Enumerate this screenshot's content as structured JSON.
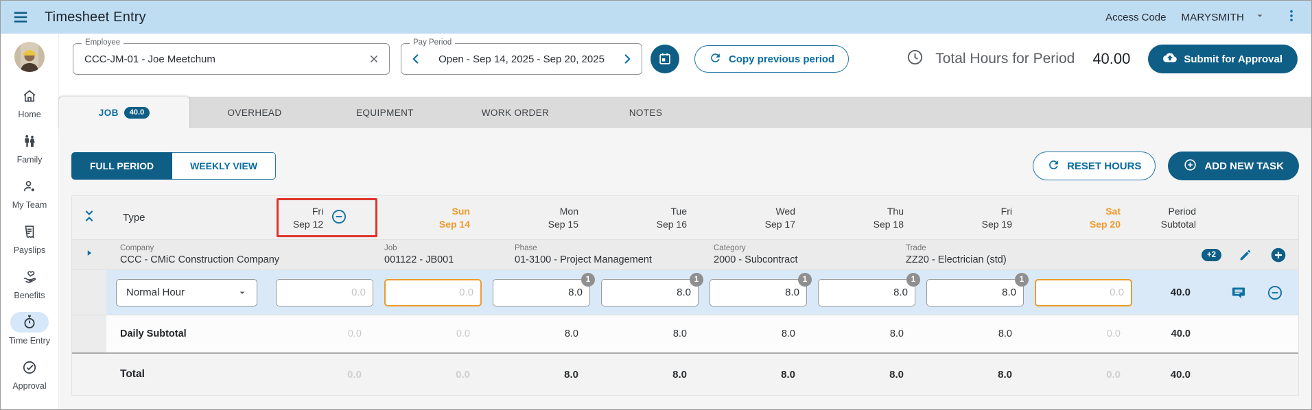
{
  "topbar": {
    "title": "Timesheet Entry",
    "access_code_label": "Access Code",
    "access_code_value": "MARYSMITH"
  },
  "sidebar": {
    "items": [
      {
        "label": "Home",
        "icon": "home-icon",
        "active": false
      },
      {
        "label": "Family",
        "icon": "family-icon",
        "active": false
      },
      {
        "label": "My Team",
        "icon": "my-team-icon",
        "active": false
      },
      {
        "label": "Payslips",
        "icon": "payslips-icon",
        "active": false
      },
      {
        "label": "Benefits",
        "icon": "benefits-icon",
        "active": false
      },
      {
        "label": "Time Entry",
        "icon": "stopwatch-icon",
        "active": true
      },
      {
        "label": "Approval",
        "icon": "check-circle-icon",
        "active": false
      }
    ]
  },
  "toolbar": {
    "employee_label": "Employee",
    "employee_value": "CCC-JM-01 - Joe Meetchum",
    "pay_period_label": "Pay Period",
    "pay_period_value": "Open - Sep 14, 2025 - Sep 20, 2025",
    "copy_previous_label": "Copy previous period",
    "total_hours_label": "Total Hours for Period",
    "total_hours_value": "40.00",
    "submit_label": "Submit for Approval"
  },
  "tabs": {
    "items": [
      {
        "label": "JOB",
        "badge": "40.0",
        "active": true
      },
      {
        "label": "OVERHEAD",
        "active": false
      },
      {
        "label": "EQUIPMENT",
        "active": false
      },
      {
        "label": "WORK ORDER",
        "active": false
      },
      {
        "label": "NOTES",
        "active": false
      }
    ]
  },
  "controls": {
    "full_period": "FULL PERIOD",
    "weekly_view": "WEEKLY VIEW",
    "selected_view": "FULL PERIOD",
    "reset_hours": "RESET HOURS",
    "add_new_task": "ADD NEW TASK"
  },
  "grid": {
    "type_header": "Type",
    "period_header_line1": "Period",
    "period_header_line2": "Subtotal",
    "days": [
      {
        "day": "Fri",
        "date": "Sep 12",
        "weekend": false,
        "highlighted": true
      },
      {
        "day": "Sun",
        "date": "Sep 14",
        "weekend": true
      },
      {
        "day": "Mon",
        "date": "Sep 15",
        "weekend": false
      },
      {
        "day": "Tue",
        "date": "Sep 16",
        "weekend": false
      },
      {
        "day": "Wed",
        "date": "Sep 17",
        "weekend": false
      },
      {
        "day": "Thu",
        "date": "Sep 18",
        "weekend": false
      },
      {
        "day": "Fri",
        "date": "Sep 19",
        "weekend": false
      },
      {
        "day": "Sat",
        "date": "Sep 20",
        "weekend": true
      }
    ],
    "task": {
      "company_label": "Company",
      "company_value": "CCC - CMiC Construction Company",
      "job_label": "Job",
      "job_value": "001122 - JB001",
      "phase_label": "Phase",
      "phase_value": "01-3100 - Project Management",
      "category_label": "Category",
      "category_value": "2000 - Subcontract",
      "trade_label": "Trade",
      "trade_value": "ZZ20 - Electrician (std)",
      "more_badge": "+2"
    },
    "hour_row": {
      "type_value": "Normal Hour",
      "cells": [
        {
          "value": "",
          "placeholder": "0.0"
        },
        {
          "value": "",
          "placeholder": "0.0"
        },
        {
          "value": "8.0",
          "placeholder": "0.0",
          "badge": "1"
        },
        {
          "value": "8.0",
          "placeholder": "0.0",
          "badge": "1"
        },
        {
          "value": "8.0",
          "placeholder": "0.0",
          "badge": "1"
        },
        {
          "value": "8.0",
          "placeholder": "0.0",
          "badge": "1"
        },
        {
          "value": "8.0",
          "placeholder": "0.0",
          "badge": "1"
        },
        {
          "value": "",
          "placeholder": "0.0"
        }
      ],
      "subtotal": "40.0"
    },
    "daily_subtotal": {
      "label": "Daily Subtotal",
      "values": [
        "0.0",
        "0.0",
        "8.0",
        "8.0",
        "8.0",
        "8.0",
        "8.0",
        "0.0"
      ],
      "total": "40.0"
    },
    "total_row": {
      "label": "Total",
      "values": [
        "0.0",
        "0.0",
        "8.0",
        "8.0",
        "8.0",
        "8.0",
        "8.0",
        "0.0"
      ],
      "total": "40.0"
    }
  },
  "colors": {
    "brand_fill": "#0E5E86",
    "brand_text": "#0A6DA1",
    "topbar_bg": "#BEDDF3",
    "hour_row_bg": "#D9E9F7",
    "weekend_orange": "#EE9B2C",
    "highlight_red": "#E0342B",
    "badge_gray": "#8F8F8F"
  }
}
